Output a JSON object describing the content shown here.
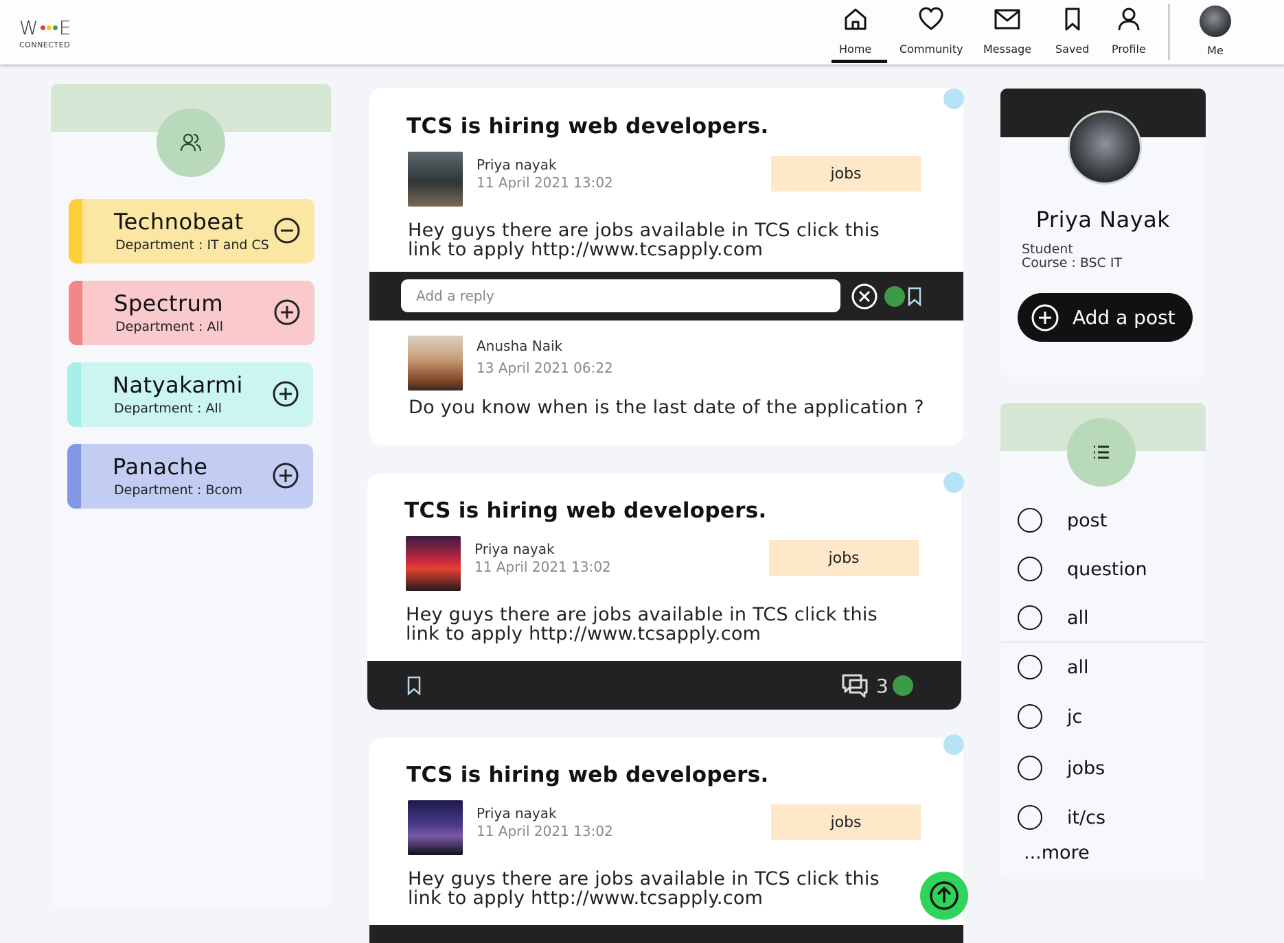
{
  "app": {
    "logo_text": "W",
    "logo_end": "E",
    "logo_sub": "CONNECTED"
  },
  "nav": {
    "items": [
      {
        "label": "Home",
        "icon": "home-icon",
        "active": true
      },
      {
        "label": "Community",
        "icon": "heart-icon"
      },
      {
        "label": "Message",
        "icon": "mail-icon"
      },
      {
        "label": "Saved",
        "icon": "bookmark-icon"
      },
      {
        "label": "Profile",
        "icon": "user-icon"
      }
    ],
    "me_label": "Me"
  },
  "clubs": [
    {
      "name": "Technobeat",
      "dept": "Department : IT and CS",
      "joined": true,
      "bg": "#fbe6a3",
      "strip": "#fbd135"
    },
    {
      "name": "Spectrum",
      "dept": "Department : All",
      "joined": false,
      "bg": "#f9c9cc",
      "strip": "#f28787"
    },
    {
      "name": "Natyakarmi",
      "dept": "Department : All",
      "joined": false,
      "bg": "#cbf5f1",
      "strip": "#a5efe7"
    },
    {
      "name": "Panache",
      "dept": "Department : Bcom",
      "joined": false,
      "bg": "#c3cdf3",
      "strip": "#8398e4"
    }
  ],
  "posts": [
    {
      "title": "TCS is hiring web developers.",
      "author": "Priya nayak",
      "timestamp": "11 April 2021 13:02",
      "tag": "jobs",
      "body": "Hey guys there are jobs available in TCS click this link to apply http://www.tcsapply.com",
      "reply_placeholder": "Add a reply",
      "reply": {
        "author": "Anusha Naik",
        "timestamp": "13 April 2021 06:22",
        "text": "Do you know when is the last date of the application ?"
      }
    },
    {
      "title": "TCS is hiring web developers.",
      "author": "Priya nayak",
      "timestamp": "11 April 2021 13:02",
      "tag": "jobs",
      "body": "Hey guys there are jobs available in TCS click this link to apply http://www.tcsapply.com",
      "comment_count": "3"
    },
    {
      "title": "TCS is hiring web developers.",
      "author": "Priya nayak",
      "timestamp": "11 April 2021 13:02",
      "tag": "jobs",
      "body": "Hey guys there are jobs available in TCS click this link to apply http://www.tcsapply.com"
    }
  ],
  "profile": {
    "name": "Priya Nayak",
    "role": "Student",
    "course": "Course : BSC IT",
    "add_post_label": "Add a post"
  },
  "filters": {
    "type_options": [
      "post",
      "question",
      "all"
    ],
    "tag_options": [
      "all",
      "jc",
      "jobs",
      "it/cs"
    ],
    "more_label": "...more"
  },
  "colors": {
    "accent_green": "#b9d9bb",
    "header_green": "#d6e6d5",
    "dark_bar": "#222222",
    "tag_bg": "#fde8c9",
    "status_dot": "#3d9a47",
    "scroll_top": "#2fd55a"
  }
}
